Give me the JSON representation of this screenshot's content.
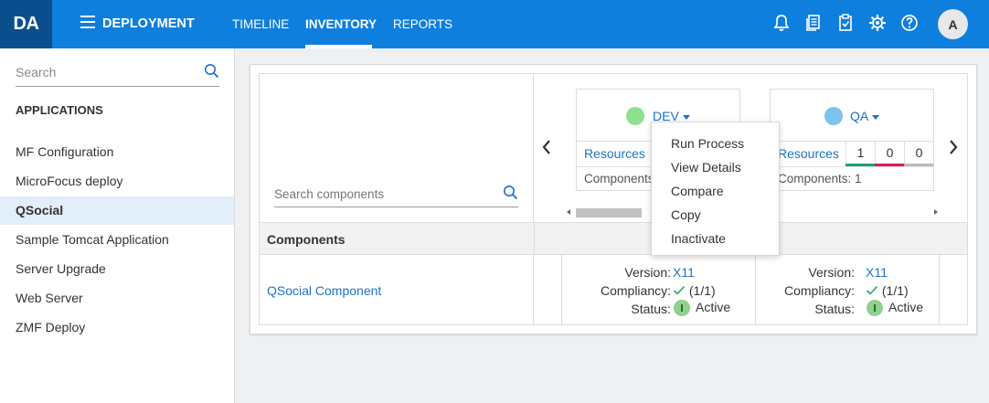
{
  "header": {
    "logo": "DA",
    "title": "DEPLOYMENT",
    "tabs": [
      {
        "label": "TIMELINE",
        "active": false
      },
      {
        "label": "INVENTORY",
        "active": true
      },
      {
        "label": "REPORTS",
        "active": false
      }
    ],
    "icons": [
      "bell-icon",
      "documents-icon",
      "clipboard-icon",
      "gear-icon",
      "help-icon"
    ],
    "avatar_initial": "A",
    "colors": {
      "bar": "#0f7fde",
      "logo_bg": "#0b4e8e"
    }
  },
  "sidebar": {
    "search_placeholder": "Search",
    "heading": "APPLICATIONS",
    "items": [
      {
        "label": "MF Configuration",
        "selected": false
      },
      {
        "label": "MicroFocus deploy",
        "selected": false
      },
      {
        "label": "QSocial",
        "selected": true
      },
      {
        "label": "Sample Tomcat Application",
        "selected": false
      },
      {
        "label": "Server Upgrade",
        "selected": false
      },
      {
        "label": "Web Server",
        "selected": false
      },
      {
        "label": "ZMF Deploy",
        "selected": false
      }
    ]
  },
  "main": {
    "component_search_placeholder": "Search components",
    "components_header": "Components",
    "component_name": "QSocial Component",
    "environments": [
      {
        "name": "DEV",
        "color": "#8ee08e",
        "resources_label": "Resources",
        "components_label": "Components: 1",
        "counts": []
      },
      {
        "name": "QA",
        "color": "#7cc4ee",
        "resources_label": "Resources",
        "components_label": "Components: 1",
        "counts": [
          {
            "value": "1",
            "color": "#1aa37a"
          },
          {
            "value": "0",
            "color": "#d81b60"
          },
          {
            "value": "0",
            "color": "#bbbbbb"
          }
        ]
      }
    ],
    "version_cells": [
      {
        "version_label": "Version:",
        "version": "X11",
        "compliancy_label": "Compliancy:",
        "compliancy": "(1/1)",
        "status_label": "Status:",
        "status": "Active"
      },
      {
        "version_label": "Version:",
        "version": "X11",
        "compliancy_label": "Compliancy:",
        "compliancy": "(1/1)",
        "status_label": "Status:",
        "status": "Active"
      }
    ]
  },
  "dropdown": {
    "items": [
      "Run Process",
      "View Details",
      "Compare",
      "Copy",
      "Inactivate"
    ]
  }
}
